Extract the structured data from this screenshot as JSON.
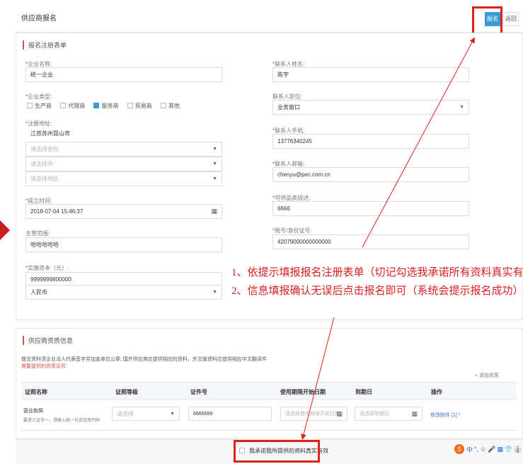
{
  "header": {
    "title": "供应商报名",
    "signup_label": "报名",
    "back_label": "返回"
  },
  "form": {
    "section_title": "报名注册表单",
    "company_name": {
      "label": "企业名称:",
      "value": "统一企业"
    },
    "company_type": {
      "label": "企业类型:",
      "options": [
        "生产商",
        "代理商",
        "服务商",
        "贸易商",
        "其他"
      ],
      "checked": "服务商"
    },
    "reg_address": {
      "label": "注册地址:",
      "value": "江苏苏州昆山市",
      "province_placeholder": "请选择省份",
      "city_placeholder": "请选择市",
      "district_placeholder": "请选择地区"
    },
    "established": {
      "label": "成立时间:",
      "value": "2018-07-04 15:46:37"
    },
    "main_business": {
      "label": "主营范围:",
      "value": "哈哈哈哈哈"
    },
    "capital": {
      "label": "实缴资本（元）:",
      "value": "9999999800000",
      "currency": "人民币"
    },
    "contact_name": {
      "label": "联系人姓名:",
      "value": "陈宇"
    },
    "contact_role": {
      "label": "联系人职位:",
      "value": "业务窗口"
    },
    "contact_phone": {
      "label": "联系人手机:",
      "value": "13776340245"
    },
    "contact_email": {
      "label": "联系人邮箱:",
      "value": "chenyu@pec.com.cn"
    },
    "supply_desc": {
      "label": "可供品类描述:",
      "value": "6666"
    },
    "id_number": {
      "label": "税号/身份证号:",
      "value": "42079000000000000"
    }
  },
  "annotation": {
    "line1": "1、依提示填报报名注册表单（切记勾选我承诺所有资料真实有效）",
    "line2": "2、信息填报确认无误后点击报名即可（系统会提示报名成功）"
  },
  "qualification": {
    "section_title": "供应商资质信息",
    "notice": "提交资料须企业法人代表签字并加盖单位公章; 国外供应商应提供相应的资料，外文版资料应提供相应中文翻译件",
    "required_note": "需要提供的资质证件:",
    "add_label": "+ 添加资质",
    "columns": [
      "证照名称",
      "证照等级",
      "证件号",
      "使用期限开始日期",
      "到期日",
      "操作"
    ],
    "rows": [
      {
        "name": "营业执照",
        "sub": "要求三证合一，请输入统一社会信用代码",
        "level_placeholder": "请选择",
        "cert_no": "6666689",
        "start_placeholder": "请选择使用期限开始日期",
        "end_placeholder": "请选择到期日",
        "action": "修改附件 [1] *"
      }
    ]
  },
  "footer": {
    "promise_label": "我承诺我所提供的资料真实有效"
  },
  "tray": {
    "items": [
      "中",
      "°,",
      "☺",
      "🎤",
      "▦",
      "👕",
      "👔"
    ]
  },
  "colors": {
    "primary": "#3a9bd8",
    "annotation": "#d81e1e",
    "required": "#e04b4b"
  }
}
